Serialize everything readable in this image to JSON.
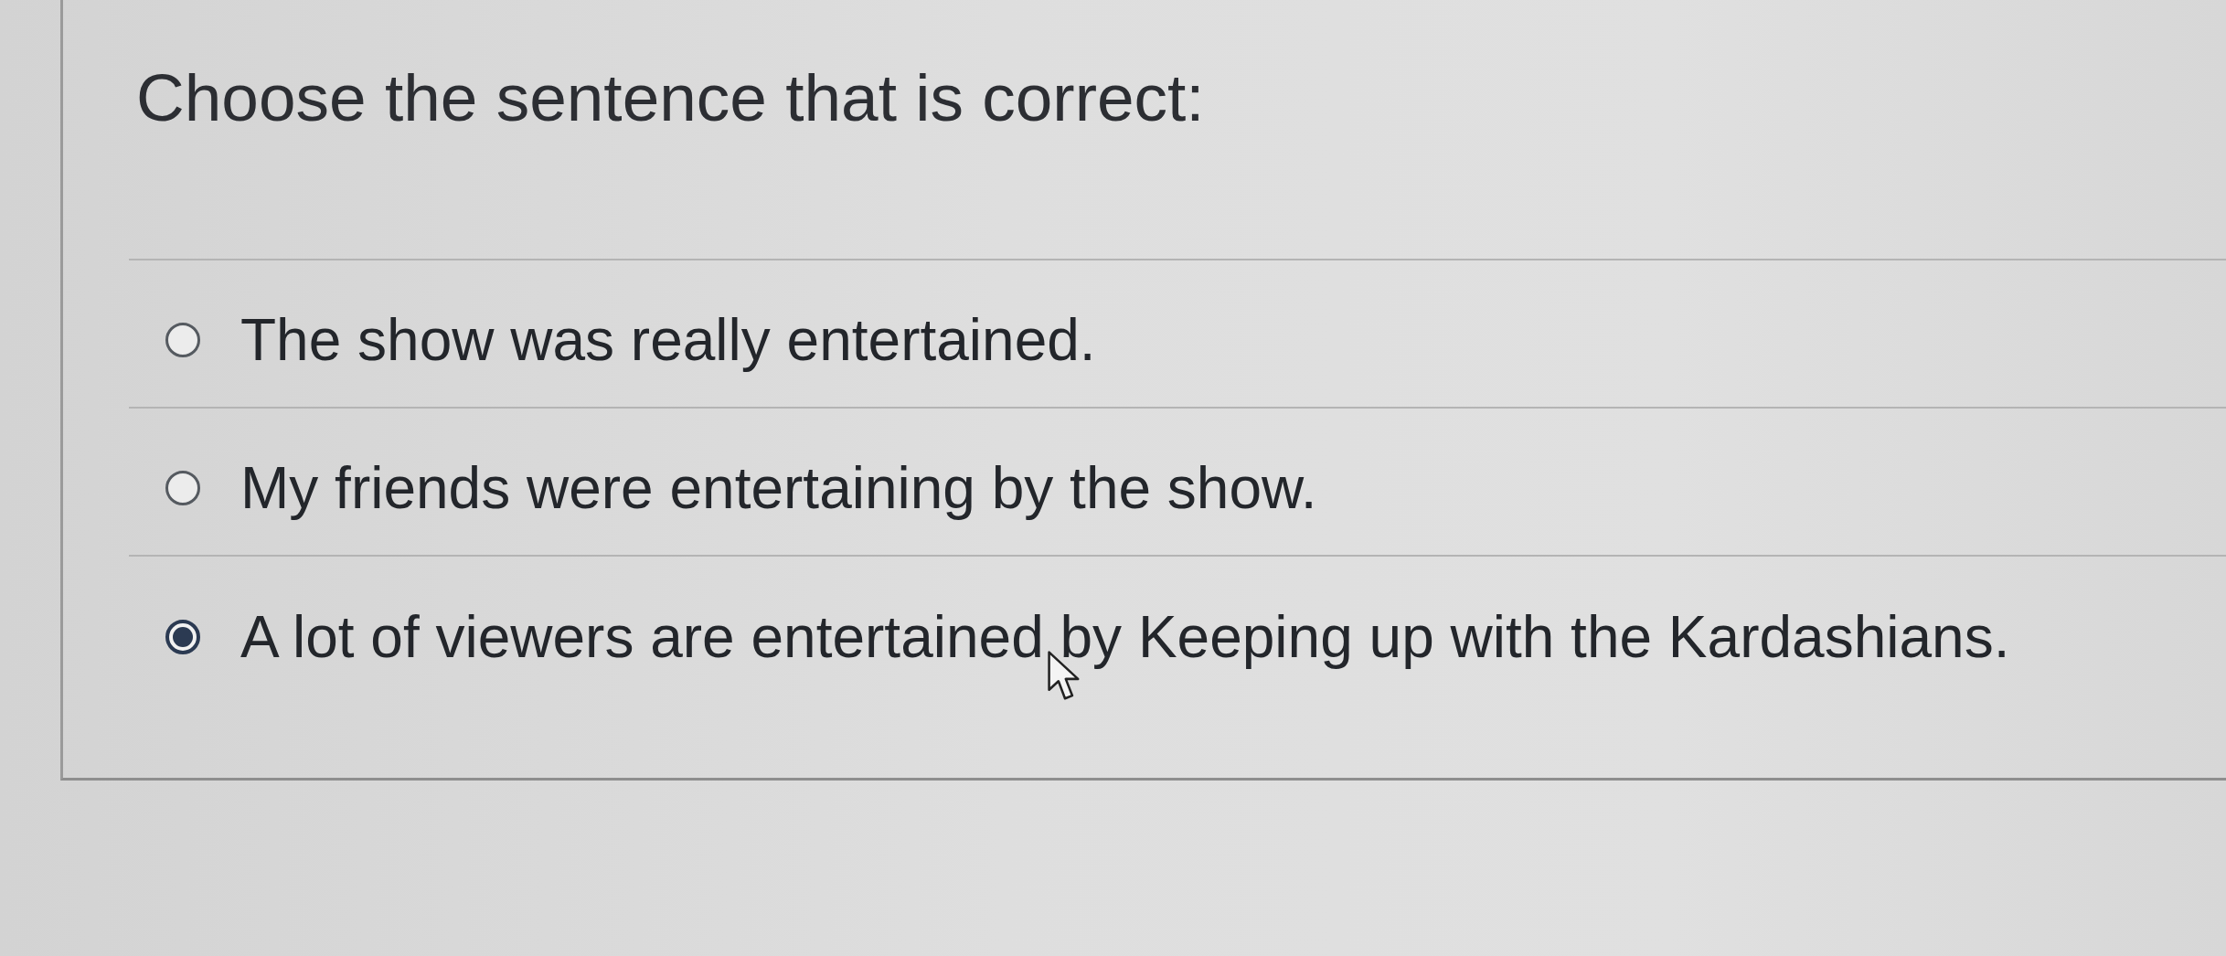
{
  "question": {
    "prompt": "Choose the sentence that is correct:"
  },
  "options": [
    {
      "text": "The show was really entertained.",
      "selected": false
    },
    {
      "text": "My friends were entertaining by the show.",
      "selected": false
    },
    {
      "text": "A lot of viewers are entertained by Keeping up with the Kardashians.",
      "selected": true
    }
  ]
}
